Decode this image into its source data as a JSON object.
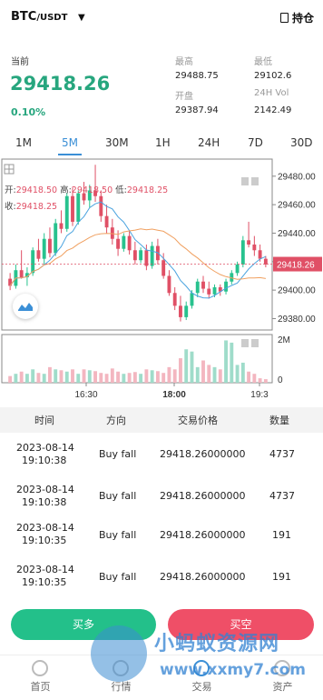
{
  "header": {
    "pair_base": "BTC",
    "pair_quote": "/USDT",
    "dropdown_icon": "caret-down-icon",
    "position_label": "持仓",
    "position_icon": "document-icon"
  },
  "price": {
    "label": "当前",
    "value": "29418.26",
    "change": "0.10%"
  },
  "stats": {
    "high_label": "最高",
    "high": "29488.75",
    "low_label": "最低",
    "low": "29102.6",
    "open_label": "开盘",
    "open": "29387.94",
    "vol_label": "24H Vol",
    "vol": "2142.49"
  },
  "tabs": [
    "1M",
    "5M",
    "30M",
    "1H",
    "24H",
    "7D",
    "30D"
  ],
  "active_tab": "5M",
  "chart": {
    "ohlc": {
      "open_label": "开:",
      "open": "29418.50",
      "high_label": "高:",
      "high": "29418.50",
      "low_label": "低:",
      "low": "29418.25",
      "close_label": "收:",
      "close": "29418.25"
    },
    "current_tag": "29418.26",
    "colors": {
      "up": "#27c28e",
      "down": "#e05066",
      "ma1": "#4aa3df",
      "ma2": "#f0a060"
    }
  },
  "chart_data": [
    {
      "type": "candlestick",
      "yticks": [
        "29480.00",
        "29460.00",
        "29440.00",
        "29420.00",
        "29400.00",
        "29380.00"
      ],
      "ylim": [
        29372,
        29492
      ],
      "xticks": [
        "16:30",
        "18:00",
        "19:3"
      ],
      "candles": [
        [
          29408,
          29412,
          29400,
          29403
        ],
        [
          29403,
          29418,
          29401,
          29414
        ],
        [
          29414,
          29428,
          29408,
          29409
        ],
        [
          29409,
          29416,
          29403,
          29412
        ],
        [
          29412,
          29430,
          29410,
          29428
        ],
        [
          29428,
          29436,
          29420,
          29422
        ],
        [
          29422,
          29440,
          29418,
          29436
        ],
        [
          29436,
          29444,
          29423,
          29426
        ],
        [
          29426,
          29450,
          29424,
          29447
        ],
        [
          29447,
          29456,
          29440,
          29443
        ],
        [
          29443,
          29468,
          29441,
          29466
        ],
        [
          29466,
          29472,
          29445,
          29448
        ],
        [
          29448,
          29470,
          29446,
          29468
        ],
        [
          29468,
          29476,
          29460,
          29463
        ],
        [
          29463,
          29474,
          29458,
          29470
        ],
        [
          29470,
          29488,
          29462,
          29466
        ],
        [
          29466,
          29470,
          29448,
          29452
        ],
        [
          29452,
          29460,
          29440,
          29444
        ],
        [
          29444,
          29450,
          29432,
          29436
        ],
        [
          29436,
          29442,
          29424,
          29429
        ],
        [
          29429,
          29440,
          29427,
          29438
        ],
        [
          29438,
          29442,
          29425,
          29428
        ],
        [
          29428,
          29434,
          29418,
          29421
        ],
        [
          29421,
          29430,
          29419,
          29428
        ],
        [
          29428,
          29432,
          29414,
          29417
        ],
        [
          29417,
          29434,
          29415,
          29431
        ],
        [
          29431,
          29436,
          29418,
          29421
        ],
        [
          29421,
          29426,
          29408,
          29410
        ],
        [
          29410,
          29414,
          29396,
          29398
        ],
        [
          29398,
          29402,
          29386,
          29389
        ],
        [
          29389,
          29396,
          29378,
          29381
        ],
        [
          29381,
          29392,
          29379,
          29389
        ],
        [
          29389,
          29400,
          29387,
          29398
        ],
        [
          29398,
          29408,
          29395,
          29406
        ],
        [
          29406,
          29410,
          29398,
          29401
        ],
        [
          29401,
          29406,
          29394,
          29397
        ],
        [
          29397,
          29404,
          29395,
          29402
        ],
        [
          29402,
          29404,
          29396,
          29399
        ],
        [
          29399,
          29408,
          29397,
          29406
        ],
        [
          29406,
          29414,
          29404,
          29412
        ],
        [
          29412,
          29420,
          29410,
          29418
        ],
        [
          29418,
          29438,
          29416,
          29435
        ],
        [
          29435,
          29448,
          29430,
          29432
        ],
        [
          29432,
          29438,
          29424,
          29428
        ],
        [
          29428,
          29432,
          29420,
          29422
        ],
        [
          29422,
          29424,
          29416,
          29418
        ]
      ],
      "volume_ylabels": [
        "2M",
        "0"
      ],
      "volume": [
        0.15,
        0.2,
        0.25,
        0.2,
        0.3,
        0.22,
        0.2,
        0.35,
        0.3,
        0.28,
        0.25,
        0.3,
        0.2,
        0.3,
        0.28,
        0.26,
        0.22,
        0.2,
        0.32,
        0.25,
        0.2,
        0.22,
        0.24,
        0.2,
        0.3,
        0.28,
        0.26,
        0.22,
        0.35,
        0.3,
        0.55,
        0.75,
        0.7,
        0.35,
        0.5,
        0.4,
        0.35,
        0.3,
        0.95,
        0.9,
        0.4,
        0.45,
        0.25,
        0.2,
        0.1,
        0.08
      ]
    }
  ],
  "trades": {
    "headers": {
      "time": "时间",
      "direction": "方向",
      "price": "交易价格",
      "qty": "数量"
    },
    "rows": [
      {
        "date": "2023-08-14",
        "time": "19:10:38",
        "direction": "Buy fall",
        "price": "29418.26000000",
        "qty": "4737"
      },
      {
        "date": "2023-08-14",
        "time": "19:10:38",
        "direction": "Buy fall",
        "price": "29418.26000000",
        "qty": "4737"
      },
      {
        "date": "2023-08-14",
        "time": "19:10:35",
        "direction": "Buy fall",
        "price": "29418.26000000",
        "qty": "191"
      },
      {
        "date": "2023-08-14",
        "time": "19:10:35",
        "direction": "Buy fall",
        "price": "29418.26000000",
        "qty": "191"
      }
    ]
  },
  "actions": {
    "buy": "买多",
    "sell": "买空"
  },
  "nav": [
    "首页",
    "行情",
    "交易",
    "资产"
  ],
  "watermark": {
    "text": "小蚂蚁资源网",
    "url": "www.xxmy7.com"
  }
}
